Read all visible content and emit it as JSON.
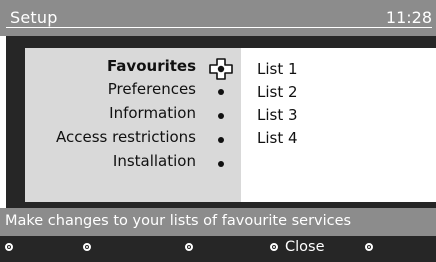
{
  "header": {
    "title": "Setup",
    "clock": "11:28"
  },
  "menu": {
    "items": [
      {
        "label": "Favourites",
        "selected": true
      },
      {
        "label": "Preferences",
        "selected": false
      },
      {
        "label": "Information",
        "selected": false
      },
      {
        "label": "Access restrictions",
        "selected": false
      },
      {
        "label": "Installation",
        "selected": false
      }
    ],
    "navigation_icon": "navigation-cross-icon"
  },
  "submenu": {
    "items": [
      "List 1",
      "List 2",
      "List 3",
      "List 4"
    ]
  },
  "help": {
    "text": "Make changes to your lists of favourite services"
  },
  "keys": [
    {
      "name": "key-1",
      "label": ""
    },
    {
      "name": "key-2",
      "label": ""
    },
    {
      "name": "key-3",
      "label": ""
    },
    {
      "name": "key-4",
      "label": "Close"
    },
    {
      "name": "key-5",
      "label": ""
    }
  ],
  "colors": {
    "bar": "#8c8c8c",
    "frame": "#262626",
    "menu_panel": "#d9d9d9",
    "submenu_panel": "#ffffff"
  }
}
